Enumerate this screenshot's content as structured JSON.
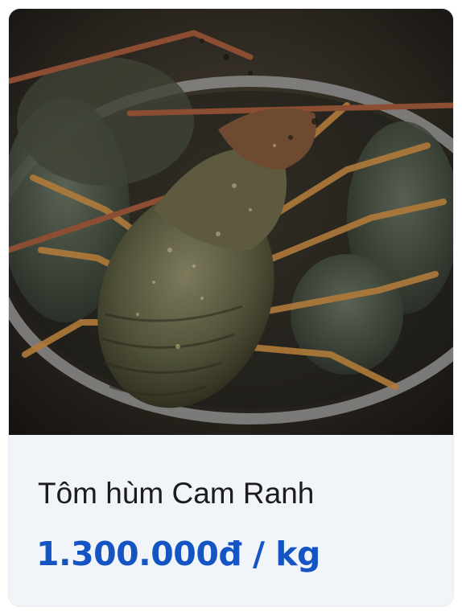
{
  "product": {
    "name": "Tôm hùm Cam Ranh",
    "price": "1.300.000đ / kg"
  },
  "colors": {
    "price": "#1554c3",
    "name": "#1c1c1e",
    "card_background": "#f1f4f8"
  }
}
